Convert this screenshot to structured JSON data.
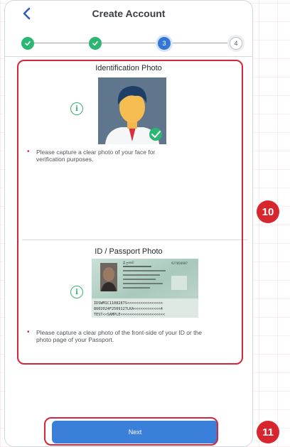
{
  "header": {
    "title": "Create Account"
  },
  "stepper": {
    "steps": [
      {
        "label": "",
        "state": "done"
      },
      {
        "label": "",
        "state": "done"
      },
      {
        "label": "3",
        "state": "active"
      },
      {
        "label": "4",
        "state": "todo"
      }
    ]
  },
  "identification": {
    "title": "Identification Photo",
    "note_line1": "Please capture a clear photo of your face for",
    "note_line2": "verification purposes."
  },
  "passport": {
    "title": "ID / Passport Photo",
    "note_line1": "Please capture a clear photo of the front-side of your ID or the",
    "note_line2": "photo page of your Passport.",
    "card_name": "ශ්‍රී ලංකාව",
    "card_number": "927856987",
    "mrz_line1": "IDSWM1C1108287S<<<<<<<<<<<<<<<<",
    "mrz_line2": "8602024F2509127LKA<<<<<<<<<<<<4",
    "mrz_line3": "TEST<<SAMPLE<<<<<<<<<<<<<<<<<<<<"
  },
  "buttons": {
    "next": "Next"
  },
  "annotations": {
    "badge_10": "10",
    "badge_11": "11"
  },
  "colors": {
    "accent": "#3a7fd9",
    "success": "#2bb673",
    "highlight": "#d5253a"
  },
  "icons": {
    "back": "chevron-left-icon",
    "info": "info-icon",
    "check": "check-icon"
  }
}
